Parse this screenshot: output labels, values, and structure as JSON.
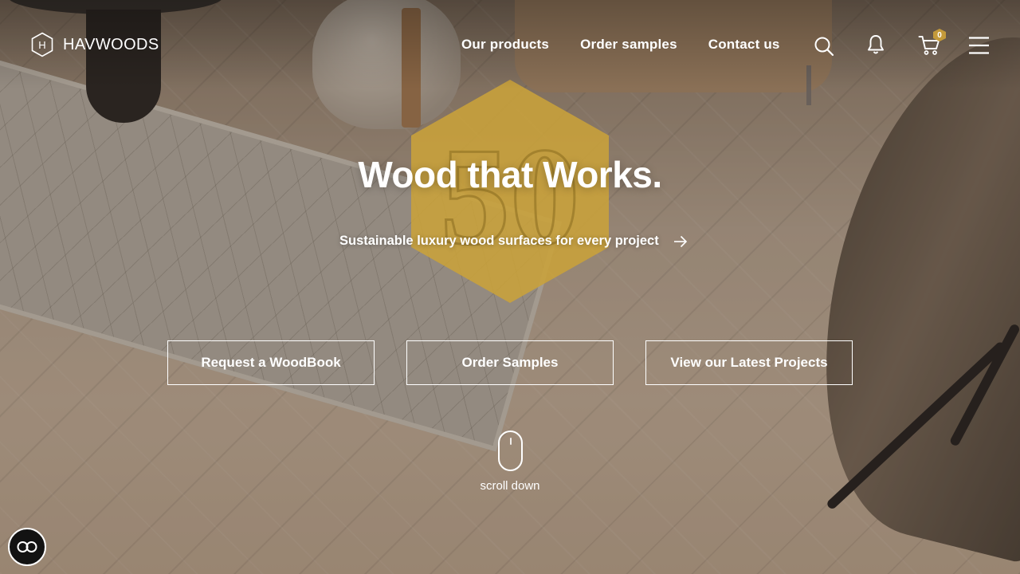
{
  "brand": {
    "name": "HAVWOODS",
    "logo_letter": "H",
    "emblem_number": "50",
    "gold": "#c9a23a"
  },
  "nav": {
    "items": [
      {
        "label": "Our products"
      },
      {
        "label": "Order samples"
      },
      {
        "label": "Contact us"
      }
    ]
  },
  "header_icons": {
    "search": "search-icon",
    "notifications": "bell-icon",
    "cart": "cart-icon",
    "cart_count": "0",
    "menu": "hamburger-menu-icon"
  },
  "hero": {
    "title": "Wood that Works.",
    "tagline": "Sustainable luxury wood surfaces for every project",
    "tagline_icon": "arrow-right-icon",
    "ctas": [
      {
        "label": "Request a WoodBook"
      },
      {
        "label": "Order Samples"
      },
      {
        "label": "View our Latest Projects"
      }
    ]
  },
  "scroll": {
    "label": "scroll down",
    "icon": "mouse-icon"
  },
  "accessibility": {
    "icon": "accessibility-toggle-icon"
  },
  "colors": {
    "text": "#ffffff",
    "badge": "#c49a3a",
    "emblem": "#c9a23a"
  }
}
